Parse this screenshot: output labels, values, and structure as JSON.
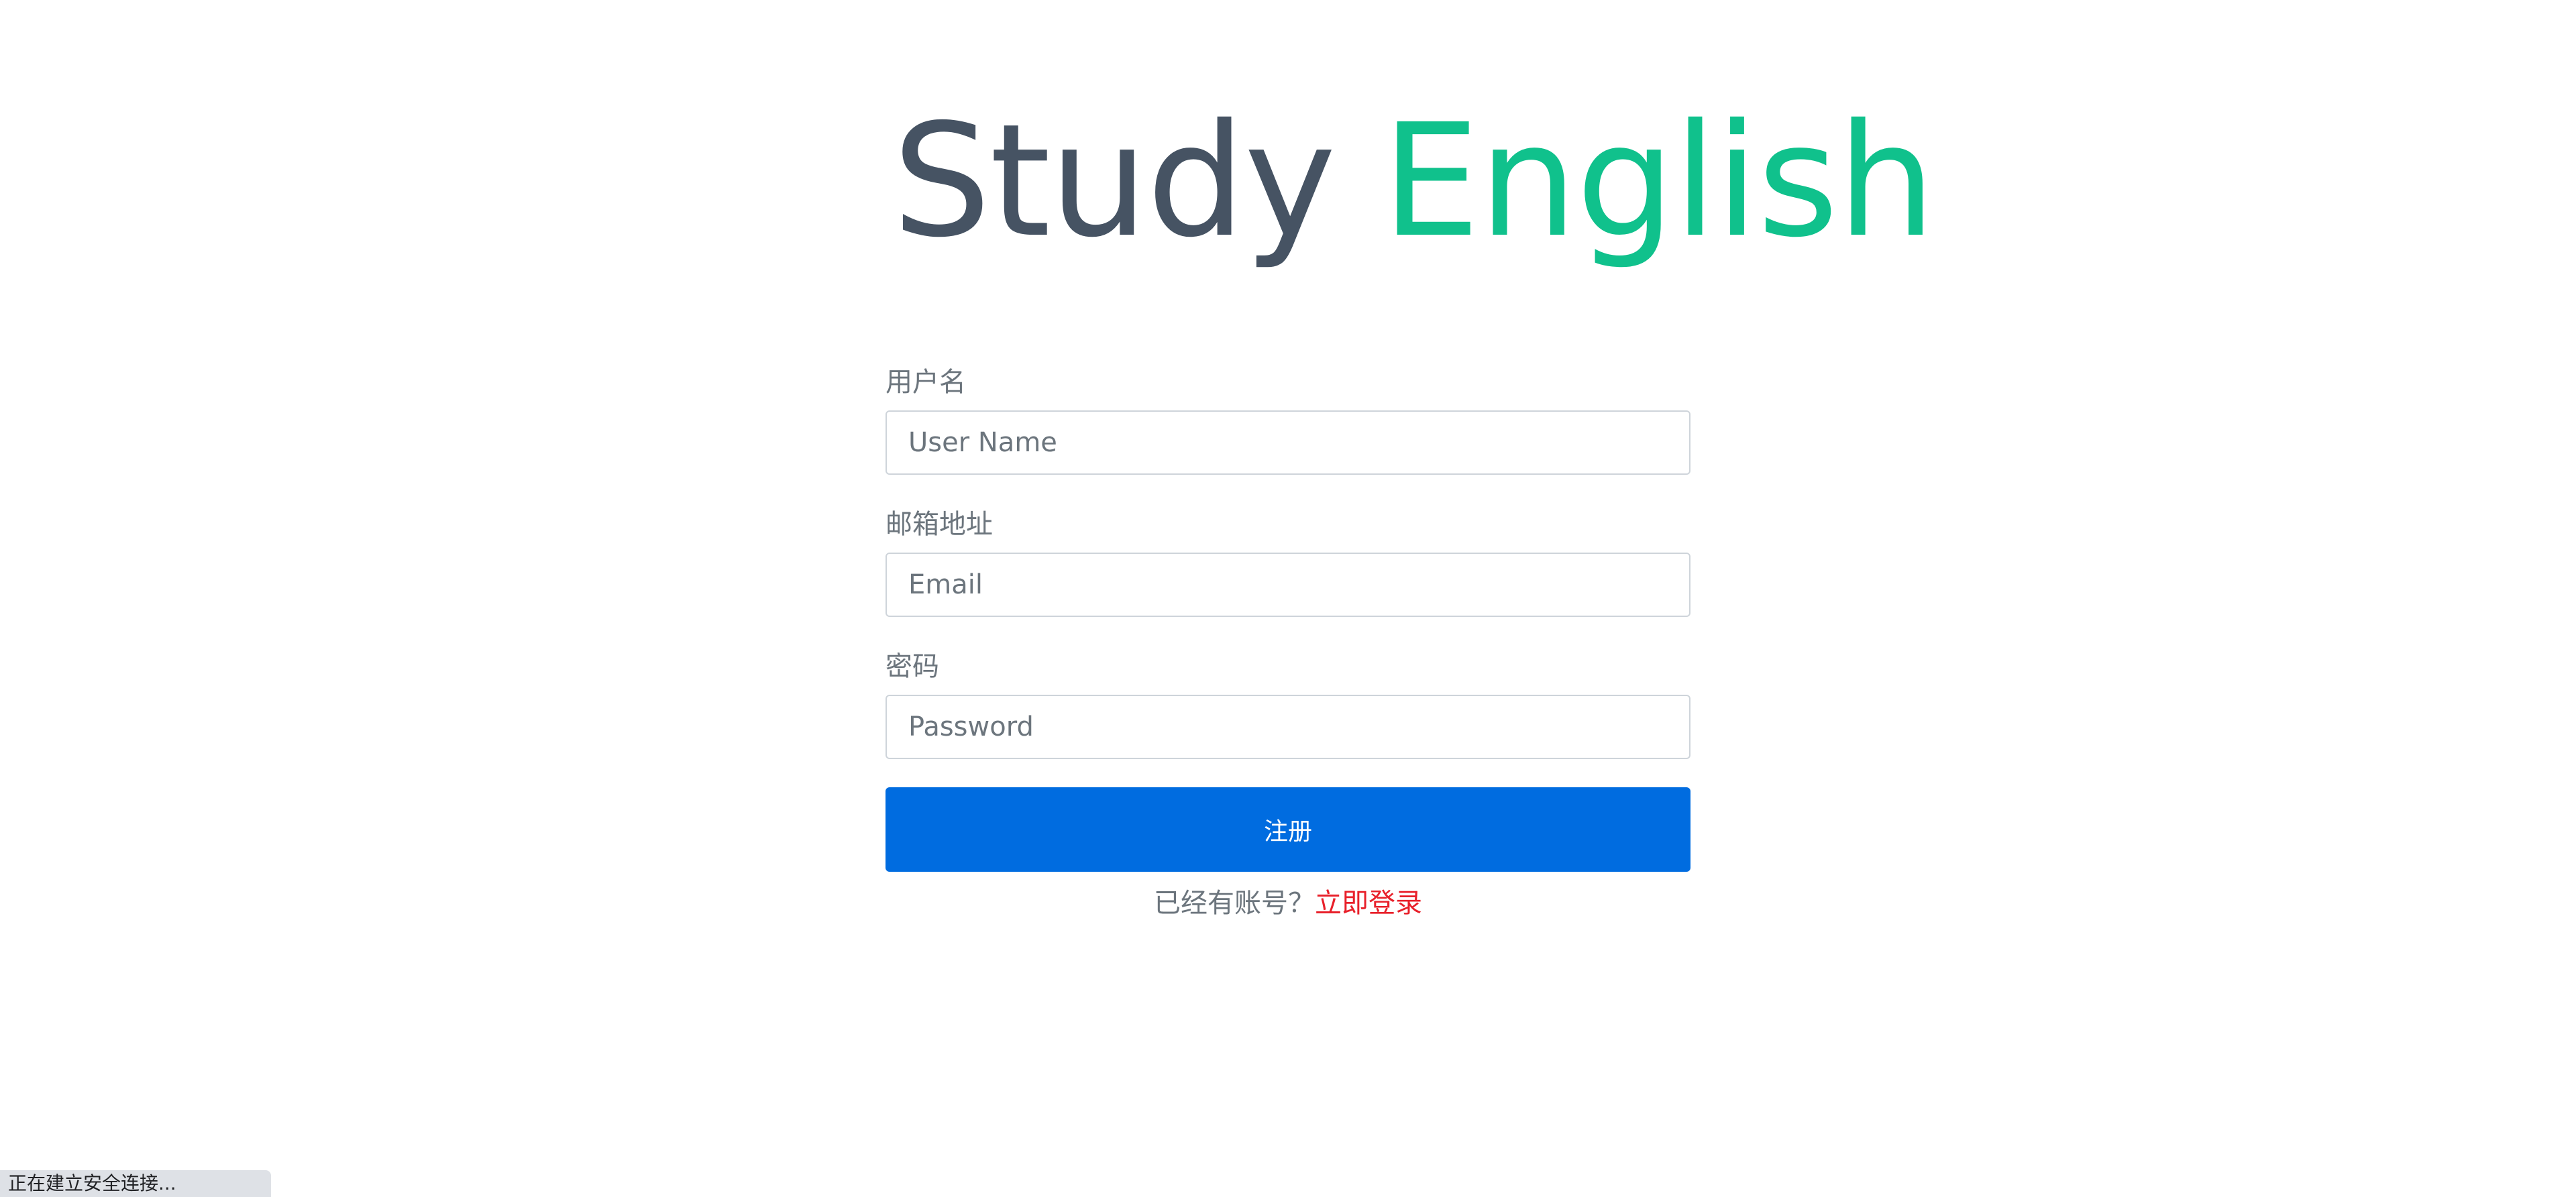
{
  "logo": {
    "word1": "Study",
    "word2": "English",
    "color1": "#465363",
    "color2": "#10c18c"
  },
  "form": {
    "username": {
      "label": "用户名",
      "placeholder": "User Name"
    },
    "email": {
      "label": "邮箱地址",
      "placeholder": "Email"
    },
    "password": {
      "label": "密码",
      "placeholder": "Password"
    },
    "submit_label": "注册",
    "submit_color": "#006ce0"
  },
  "footer": {
    "prompt": "已经有账号？",
    "login_link": "立即登录",
    "link_color": "#e8202a"
  },
  "status_bar": {
    "text": "正在建立安全连接..."
  }
}
